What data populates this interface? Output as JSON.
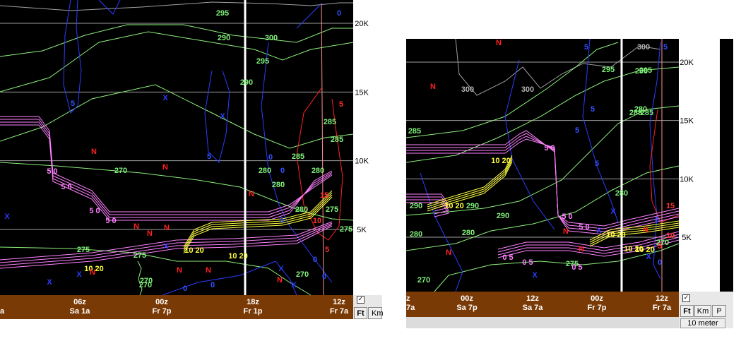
{
  "chart_data": [
    {
      "type": "contour",
      "title": "",
      "altitude_axis": {
        "labels": [
          "20K",
          "15K",
          "10K",
          "5K"
        ],
        "values_ft": [
          20000,
          15000,
          10000,
          5000
        ],
        "side": "right"
      },
      "time_axis": {
        "labels": [
          {
            "top": "",
            "bottom": "a"
          },
          {
            "top": "06z",
            "bottom": "Sa 1a"
          },
          {
            "top": "00z",
            "bottom": "Fr 7p"
          },
          {
            "top": "18z",
            "bottom": "Fr 1p"
          },
          {
            "top": "12z",
            "bottom": "Fr 7a"
          }
        ]
      },
      "units_toggle": [
        "Ft",
        "Km"
      ],
      "selected_unit": "Ft",
      "checkbox_checked": true,
      "current_time_marker": "18z",
      "isentrope_labels": [
        "295",
        "290",
        "300",
        "295",
        "290",
        "285",
        "285",
        "285",
        "280",
        "280",
        "280",
        "280",
        "275",
        "275",
        "275",
        "275",
        "270",
        "270",
        "270",
        "270",
        "280"
      ],
      "wind_labels_blue": [
        "0",
        "5",
        "5",
        "0",
        "0",
        "5",
        "0",
        "0",
        "0",
        "0"
      ],
      "wind_labels_red": [
        "5",
        "10",
        "15",
        "5"
      ],
      "wind_labels_pink": [
        "5 0",
        "5 0",
        "5 0",
        "5 0"
      ],
      "wind_labels_yellow": [
        "10 20",
        "10 20",
        "10 20"
      ],
      "markers": [
        "N",
        "X"
      ],
      "colors": {
        "isentropes": "#8cf07a",
        "wind_speed_blue": "#2b3cff",
        "wind_speed_red": "#ff2020",
        "pink": "#ff80ff",
        "yellow": "#ffff40",
        "time_bar": "#7a3a05",
        "background": "#000000"
      }
    },
    {
      "type": "contour",
      "title": "",
      "altitude_axis": {
        "labels": [
          "20K",
          "15K",
          "10K",
          "5K"
        ],
        "values_ft": [
          20000,
          15000,
          10000,
          5000
        ],
        "side": "right"
      },
      "time_axis": {
        "labels": [
          {
            "top": "z",
            "bottom": "7a"
          },
          {
            "top": "00z",
            "bottom": "Sa 7p"
          },
          {
            "top": "12z",
            "bottom": "Sa 7a"
          },
          {
            "top": "00z",
            "bottom": "Fr 7p"
          },
          {
            "top": "12z",
            "bottom": "Fr 7a"
          }
        ]
      },
      "units_toggle": [
        "Ft",
        "Km",
        "P"
      ],
      "selected_unit": "Ft",
      "checkbox_checked": true,
      "footer_label": "10 meter",
      "current_time_marker": "00z",
      "isentrope_labels": [
        "300",
        "300",
        "300",
        "295",
        "295",
        "290",
        "290",
        "290",
        "290",
        "285",
        "285",
        "285",
        "280",
        "280",
        "280",
        "280",
        "275",
        "270",
        "270"
      ],
      "wind_labels_blue": [
        "5",
        "5",
        "5",
        "5",
        "5",
        "0",
        "0"
      ],
      "wind_labels_red": [
        "15",
        "10",
        "5"
      ],
      "wind_labels_pink": [
        "5 0",
        "5 0",
        "5 0",
        "0 5",
        "0 5",
        "0 5"
      ],
      "wind_labels_yellow": [
        "10 20",
        "10 20",
        "10 20",
        "10 20",
        "10 20"
      ],
      "markers": [
        "N",
        "X"
      ],
      "colors": {
        "isentropes": "#8cf07a",
        "wind_speed_blue": "#2b3cff",
        "wind_speed_red": "#ff2020",
        "pink": "#ff80ff",
        "yellow": "#ffff40",
        "time_bar": "#7a3a05",
        "background": "#000000"
      }
    }
  ]
}
